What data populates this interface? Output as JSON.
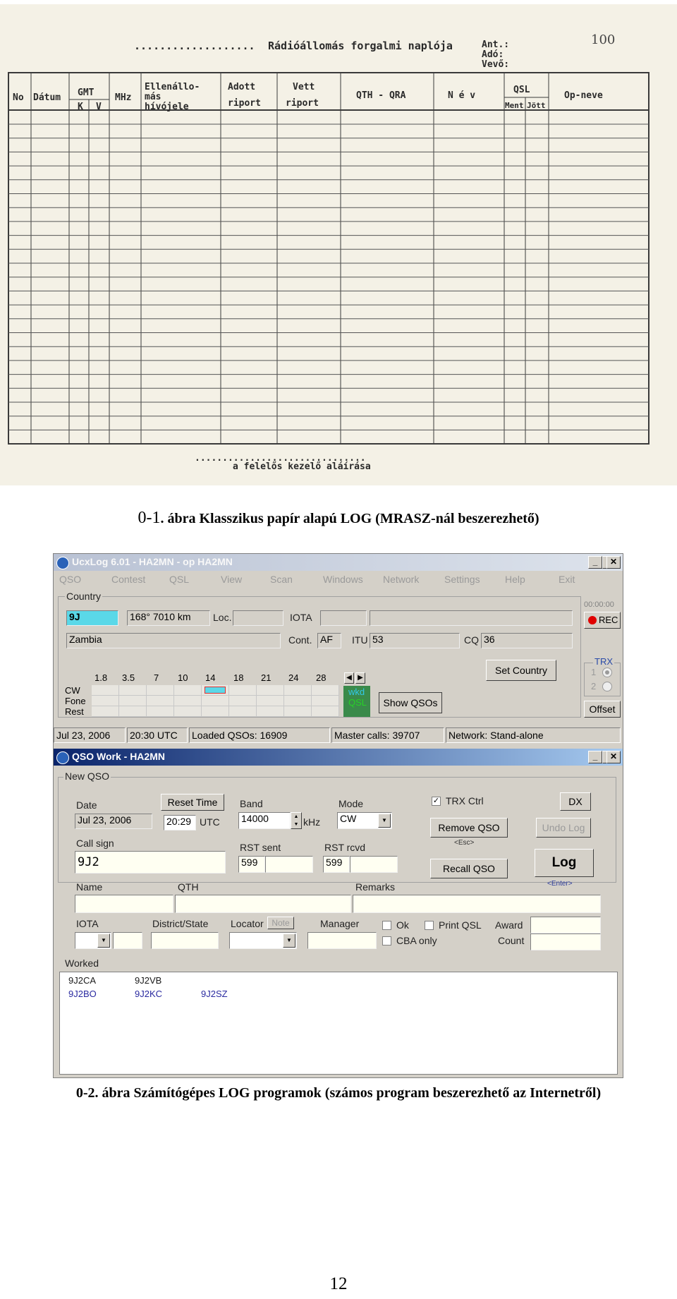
{
  "figure1": {
    "title_dots": "...................",
    "title": "Rádióállomás forgalmi naplója",
    "equip": [
      "Ant.:",
      "Adó:",
      "Vevő:"
    ],
    "page_number": "100",
    "headers": {
      "no": "No",
      "datum": "Dátum",
      "gmt": "GMT",
      "gmt_k": "K",
      "gmt_v": "V",
      "mhz": "MHz",
      "ellen": [
        "Ellenállo-",
        "más",
        "hívójele"
      ],
      "adott": [
        "Adott",
        "riport"
      ],
      "vett": [
        "Vett",
        "riport"
      ],
      "qth": "QTH - QRA",
      "nev": "N é v",
      "qsl": "QSL",
      "qsl_ment": "Ment",
      "qsl_jott": "Jött",
      "opneve": "Op-neve"
    },
    "footer_dots": "...............................",
    "footer": "a felelős kezelő aláírása"
  },
  "caption1": {
    "number": "0-1",
    "text": ". ábra Klasszikus papír alapú LOG (MRASZ-nál beszerezhető)"
  },
  "main_window": {
    "title": "UcxLog 6.01 - HA2MN - op HA2MN",
    "menu": [
      "QSO",
      "Contest",
      "QSL",
      "View",
      "Scan",
      "Windows",
      "Network",
      "Settings",
      "Help",
      "Exit"
    ],
    "country_group": "Country",
    "prefix": "9J",
    "bearing_distance": "168°  7010 km",
    "loc_label": "Loc.",
    "iota_label": "IOTA",
    "country_name": "Zambia",
    "cont_label": "Cont.",
    "cont_value": "AF",
    "itu_label": "ITU",
    "itu_value": "53",
    "cq_label": "CQ",
    "cq_value": "36",
    "bands": [
      "1.8",
      "3.5",
      "7",
      "10",
      "14",
      "18",
      "21",
      "24",
      "28"
    ],
    "modes": [
      "CW",
      "Fone",
      "Rest"
    ],
    "wkd": "wkd",
    "qsl": "QSL",
    "show_qsos": "Show QSOs",
    "set_country": "Set Country",
    "timer": "00:00:00",
    "rec": "REC",
    "trx_label": "TRX",
    "trx_options": [
      "1",
      "2"
    ],
    "offset": "Offset",
    "status": {
      "date": "Jul 23, 2006",
      "time": "20:30 UTC",
      "loaded": "Loaded QSOs: 16909",
      "master": "Master calls: 39707",
      "network": "Network: Stand-alone"
    }
  },
  "qso_window": {
    "title": "QSO Work - HA2MN",
    "group": "New QSO",
    "date_label": "Date",
    "date_value": "Jul 23, 2006",
    "reset_time": "Reset Time",
    "time_value": "20:29",
    "utc": "UTC",
    "band_label": "Band",
    "band_value": "14000",
    "khz": "kHz",
    "mode_label": "Mode",
    "mode_value": "CW",
    "trx_ctrl": "TRX Ctrl",
    "dx": "DX",
    "remove_qso": "Remove QSO",
    "esc": "<Esc>",
    "undo_log": "Undo Log",
    "call_label": "Call sign",
    "call_value": "9J2",
    "rst_sent_label": "RST sent",
    "rst_sent_value": "599",
    "rst_rcvd_label": "RST rcvd",
    "rst_rcvd_value": "599",
    "recall_qso": "Recall QSO",
    "log": "Log",
    "enter": "<Enter>",
    "name_label": "Name",
    "qth_label": "QTH",
    "remarks_label": "Remarks",
    "iota_label": "IOTA",
    "district_label": "District/State",
    "locator_label": "Locator",
    "note": "Note",
    "manager_label": "Manager",
    "ok": "Ok",
    "print_qsl": "Print QSL",
    "cba_only": "CBA only",
    "award_label": "Award",
    "count_label": "Count",
    "worked_label": "Worked",
    "worked_row1": [
      "9J2CA",
      "9J2VB"
    ],
    "worked_row2": [
      "9J2BO",
      "9J2KC",
      "9J2SZ"
    ],
    "colors": {
      "highlight": "#5ad8e8",
      "wkd": "#33c8e8",
      "qsl": "#28d028",
      "worked_dark": "#1a1a1a",
      "worked_blue": "#2a2aa0"
    }
  },
  "caption2": {
    "number": "0-2",
    "text": ". ábra Számítógépes LOG programok (számos program beszerezhető az Internetről)"
  },
  "page_number": "12"
}
